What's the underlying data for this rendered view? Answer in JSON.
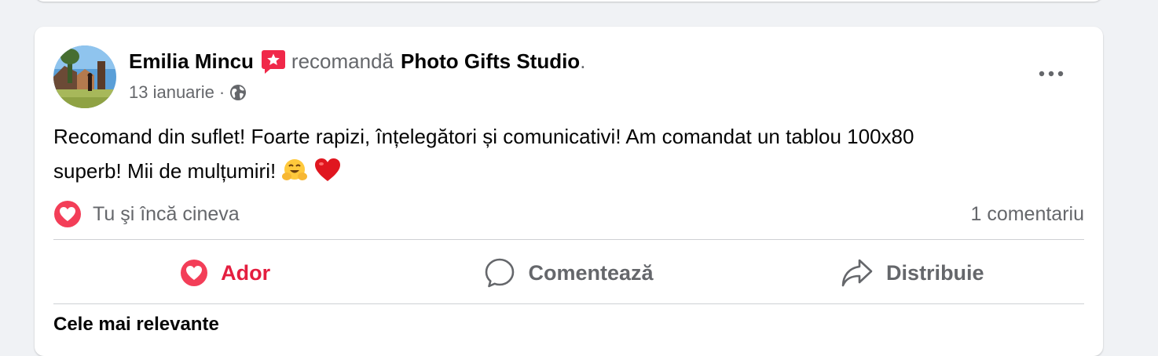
{
  "post": {
    "author": "Emilia Mincu",
    "verb": "recomandă",
    "page_name": "Photo Gifts Studio",
    "trailing_dot": ".",
    "date": "13 ianuarie",
    "meta_separator": "·",
    "privacy_icon": "globe-icon",
    "text_line1": "Recomand din suflet! Foarte rapizi, înțelegători și comunicativi! Am comandat un tablou 100x80",
    "text_line2": "superb! Mii de mulțumiri!",
    "text_emojis": [
      "hugging-face-emoji",
      "red-heart-emoji"
    ]
  },
  "reactions": {
    "summary": "Tu şi încă cineva",
    "icon": "love-reaction-icon",
    "comments_count": "1 comentariu"
  },
  "actions": {
    "love_label": "Ador",
    "comment_label": "Comentează",
    "share_label": "Distribuie"
  },
  "comments": {
    "sort_label": "Cele mai relevante"
  },
  "colors": {
    "page_bg": "#f0f2f5",
    "card_bg": "#ffffff",
    "text_primary": "#050505",
    "text_secondary": "#65676b",
    "love_red": "#e41e3f",
    "recommend_badge": "#f02849",
    "divider": "#ced0d4"
  }
}
